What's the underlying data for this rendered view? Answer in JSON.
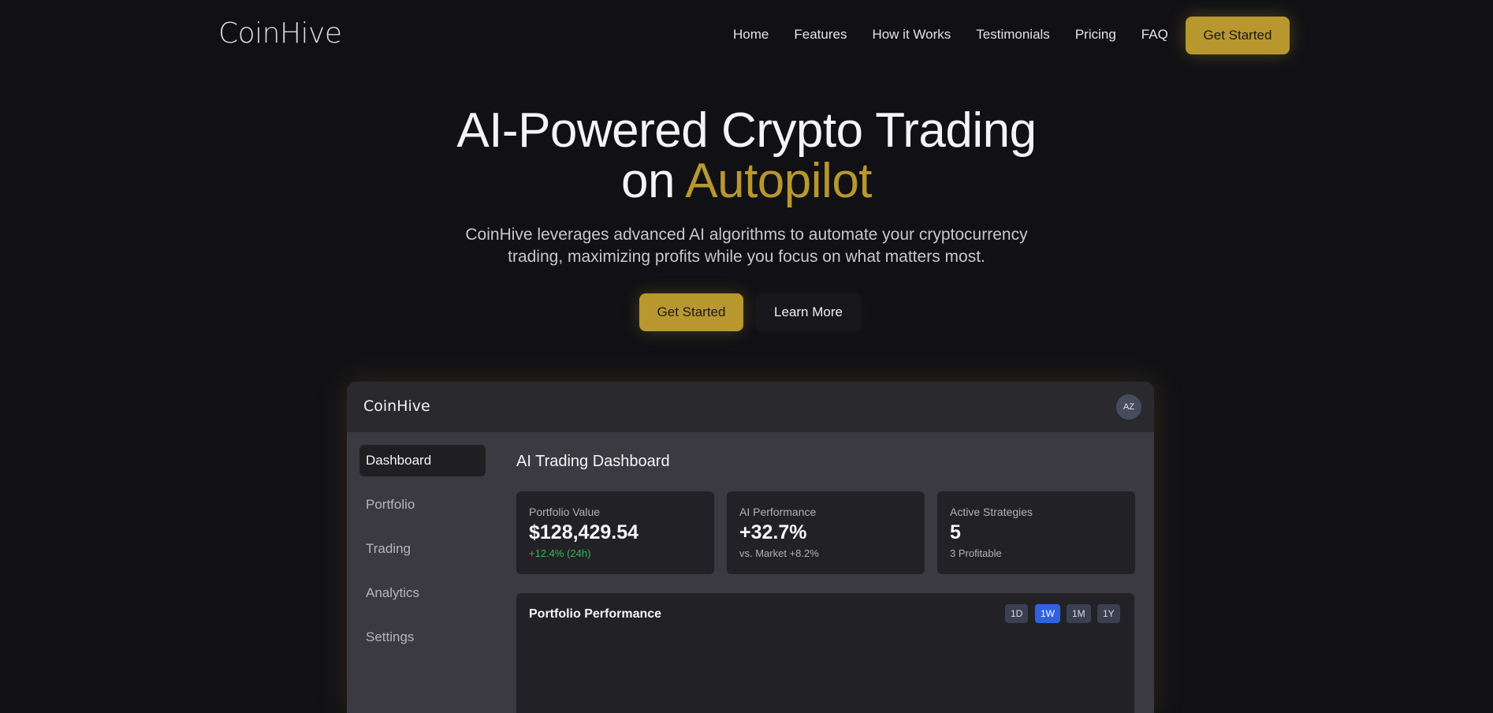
{
  "nav": {
    "logo": "CoinHive",
    "links": [
      "Home",
      "Features",
      "How it Works",
      "Testimonials",
      "Pricing",
      "FAQ"
    ],
    "cta": "Get Started"
  },
  "hero": {
    "title_line1": "AI-Powered Crypto Trading",
    "title_line2_prefix": "on ",
    "title_line2_accent": "Autopilot",
    "subtitle": "CoinHive leverages advanced AI algorithms to automate your cryptocurrency trading, maximizing profits while you focus on what matters most.",
    "primary_button": "Get Started",
    "secondary_button": "Learn More"
  },
  "app": {
    "logo": "CoinHive",
    "avatar": "AZ",
    "sidebar": [
      "Dashboard",
      "Portfolio",
      "Trading",
      "Analytics",
      "Settings"
    ],
    "active_sidebar": "Dashboard",
    "title": "AI Trading Dashboard",
    "cards": [
      {
        "label": "Portfolio Value",
        "value": "$128,429.54",
        "sub": "+12.4% (24h)"
      },
      {
        "label": "AI Performance",
        "value": "+32.7%",
        "sub": "vs. Market +8.2%"
      },
      {
        "label": "Active Strategies",
        "value": "5",
        "sub": "3 Profitable"
      }
    ],
    "performance": {
      "title": "Portfolio Performance",
      "ranges": [
        "1D",
        "1W",
        "1M",
        "1Y"
      ],
      "active_range": "1W"
    }
  },
  "colors": {
    "background": "#111115",
    "accent_gold": "#b8972f",
    "positive_green": "#2fb85a",
    "active_blue": "#2f62e0"
  }
}
